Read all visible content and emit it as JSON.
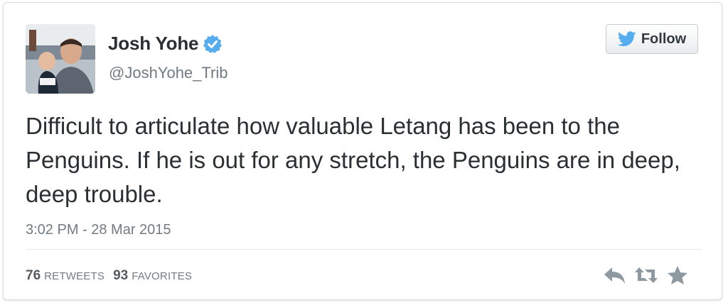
{
  "user": {
    "display_name": "Josh Yohe",
    "handle": "@JoshYohe_Trib",
    "verified": true,
    "verified_color": "#55acee"
  },
  "follow_button": {
    "label": "Follow",
    "icon": "twitter-bird-icon",
    "icon_color": "#55acee"
  },
  "tweet": {
    "text": "Difficult to articulate how valuable Letang has been to the Penguins. If he is out for any stretch, the Penguins are in deep, deep trouble.",
    "timestamp": "3:02 PM - 28 Mar 2015"
  },
  "stats": {
    "retweets_count": "76",
    "retweets_label": "RETWEETS",
    "favorites_count": "93",
    "favorites_label": "FAVORITES"
  },
  "actions": {
    "reply_icon": "reply-icon",
    "retweet_icon": "retweet-icon",
    "favorite_icon": "star-icon",
    "icon_color": "#8e989f"
  }
}
